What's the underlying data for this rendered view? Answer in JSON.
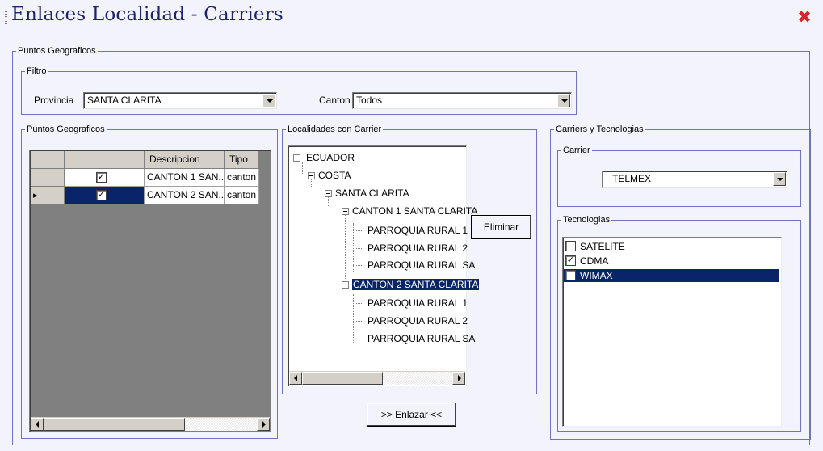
{
  "window": {
    "title": "Enlaces Localidad - Carriers",
    "close_glyph": "✖"
  },
  "geo_group": {
    "legend": "Puntos Geograficos",
    "filter": {
      "legend": "Filtro",
      "provincia_label": "Provincia",
      "provincia_value": "SANTA CLARITA",
      "canton_label": "Canton",
      "canton_value": "Todos"
    },
    "points": {
      "legend": "Puntos Geograficos",
      "columns": [
        "",
        "",
        "Descripcion",
        "Tipo"
      ],
      "rows": [
        {
          "checked": true,
          "descripcion": "CANTON 1 SAN...",
          "tipo": "canton",
          "selected": false
        },
        {
          "checked": true,
          "descripcion": "CANTON 2 SAN...",
          "tipo": "canton",
          "selected": true
        }
      ],
      "row_indicator": "▸"
    },
    "localities": {
      "legend": "Localidades con Carrier",
      "tree": {
        "ecuador": "ECUADOR",
        "costa": "COSTA",
        "santa_clarita": "SANTA CLARITA",
        "canton1": "CANTON 1 SANTA CLARITA",
        "canton1_children": [
          "PARROQUIA RURAL 1",
          "PARROQUIA RURAL 2",
          "PARROQUIA RURAL SA"
        ],
        "canton2": "CANTON 2 SANTA CLARITA",
        "canton2_children": [
          "PARROQUIA RURAL 1",
          "PARROQUIA RURAL 2",
          "PARROQUIA RURAL SA"
        ]
      },
      "delete_button": "Eliminar",
      "link_button": ">> Enlazar <<"
    },
    "carriers": {
      "legend": "Carriers y Tecnologias",
      "carrier_legend": "Carrier",
      "carrier_value": "TELMEX",
      "tech_legend": "Tecnologias",
      "technologies": [
        {
          "name": "SATELITE",
          "checked": false,
          "selected": false
        },
        {
          "name": "CDMA",
          "checked": true,
          "selected": false
        },
        {
          "name": "WIMAX",
          "checked": true,
          "selected": true
        }
      ]
    }
  }
}
